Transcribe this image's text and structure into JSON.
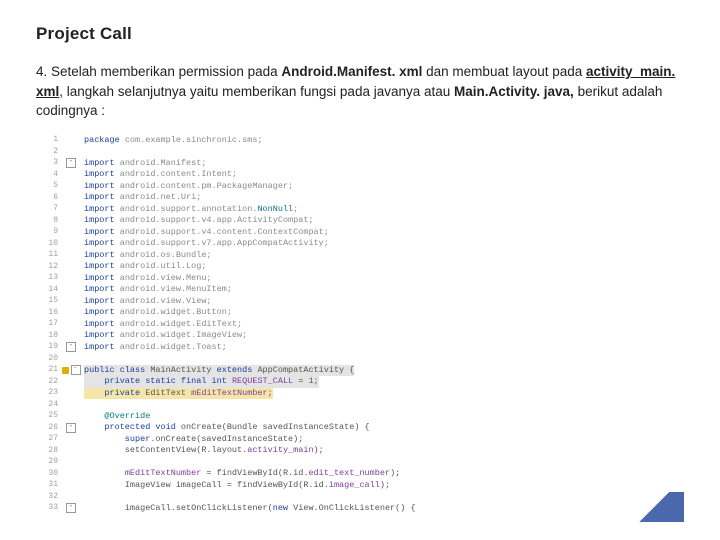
{
  "title": "Project Call",
  "paragraph": {
    "prefix": "4. Setelah memberikan permission pada ",
    "b1": "Android.Manifest. xml",
    "mid1": " dan membuat layout pada ",
    "b2": "activity_main. xml",
    "mid2": ", langkah selanjutnya yaitu memberikan fungsi pada javanya atau ",
    "b3": "Main.Activity. java,",
    "suffix": " berikut adalah codingnya :"
  },
  "lines": [
    {
      "n": 1,
      "fold": "",
      "code": [
        [
          "kw",
          "package "
        ],
        [
          "grey",
          "com.example.sinchronic.sms;"
        ]
      ]
    },
    {
      "n": 2,
      "fold": "",
      "code": []
    },
    {
      "n": 3,
      "fold": "-",
      "code": [
        [
          "kw",
          "import "
        ],
        [
          "grey",
          "android.Manifest;"
        ]
      ]
    },
    {
      "n": 4,
      "fold": "",
      "code": [
        [
          "kw",
          "import "
        ],
        [
          "grey",
          "android.content.Intent;"
        ]
      ]
    },
    {
      "n": 5,
      "fold": "",
      "code": [
        [
          "kw",
          "import "
        ],
        [
          "grey",
          "android.content.pm.PackageManager;"
        ]
      ]
    },
    {
      "n": 6,
      "fold": "",
      "code": [
        [
          "kw",
          "import "
        ],
        [
          "grey",
          "android.net.Uri;"
        ]
      ]
    },
    {
      "n": 7,
      "fold": "",
      "code": [
        [
          "kw",
          "import "
        ],
        [
          "grey",
          "android.support.annotation."
        ],
        [
          "teal",
          "NonNull"
        ],
        [
          "grey",
          ";"
        ]
      ]
    },
    {
      "n": 8,
      "fold": "",
      "code": [
        [
          "kw",
          "import "
        ],
        [
          "grey",
          "android.support.v4.app.ActivityCompat;"
        ]
      ]
    },
    {
      "n": 9,
      "fold": "",
      "code": [
        [
          "kw",
          "import "
        ],
        [
          "grey",
          "android.support.v4.content.ContextCompat;"
        ]
      ]
    },
    {
      "n": 10,
      "fold": "",
      "code": [
        [
          "kw",
          "import "
        ],
        [
          "grey",
          "android.support.v7.app.AppCompatActivity;"
        ]
      ]
    },
    {
      "n": 11,
      "fold": "",
      "code": [
        [
          "kw",
          "import "
        ],
        [
          "grey",
          "android.os.Bundle;"
        ]
      ]
    },
    {
      "n": 12,
      "fold": "",
      "code": [
        [
          "kw",
          "import "
        ],
        [
          "grey",
          "android.util.Log;"
        ]
      ]
    },
    {
      "n": 13,
      "fold": "",
      "code": [
        [
          "kw",
          "import "
        ],
        [
          "grey",
          "android.view.Menu;"
        ]
      ]
    },
    {
      "n": 14,
      "fold": "",
      "code": [
        [
          "kw",
          "import "
        ],
        [
          "grey",
          "android.view.MenuItem;"
        ]
      ]
    },
    {
      "n": 15,
      "fold": "",
      "code": [
        [
          "kw",
          "import "
        ],
        [
          "grey",
          "android.view.View;"
        ]
      ]
    },
    {
      "n": 16,
      "fold": "",
      "code": [
        [
          "kw",
          "import "
        ],
        [
          "grey",
          "android.widget.Button;"
        ]
      ]
    },
    {
      "n": 17,
      "fold": "",
      "code": [
        [
          "kw",
          "import "
        ],
        [
          "grey",
          "android.widget.EditText;"
        ]
      ]
    },
    {
      "n": 18,
      "fold": "",
      "code": [
        [
          "kw",
          "import "
        ],
        [
          "grey",
          "android.widget.ImageView;"
        ]
      ]
    },
    {
      "n": 19,
      "fold": "-",
      "code": [
        [
          "kw",
          "import "
        ],
        [
          "grey",
          "android.widget.Toast;"
        ]
      ]
    },
    {
      "n": 20,
      "fold": "",
      "code": []
    },
    {
      "n": 21,
      "fold": "-",
      "hl": "grey",
      "warn": true,
      "code": [
        [
          "kw",
          "public class "
        ],
        [
          "",
          "MainActivity "
        ],
        [
          "kw",
          "extends "
        ],
        [
          "",
          "AppCompatActivity {"
        ]
      ]
    },
    {
      "n": 22,
      "fold": "",
      "hl": "grey",
      "code": [
        [
          "kw",
          "    private static final int "
        ],
        [
          "purple",
          "REQUEST_CALL"
        ],
        [
          "",
          " = "
        ],
        [
          "",
          "1"
        ],
        [
          "",
          ";"
        ]
      ]
    },
    {
      "n": 23,
      "fold": "",
      "hl": "yellow",
      "code": [
        [
          "kw",
          "    private "
        ],
        [
          "",
          "EditText "
        ],
        [
          "purple",
          "mEditTextNumber"
        ],
        [
          "",
          ";"
        ]
      ]
    },
    {
      "n": 24,
      "fold": "",
      "code": []
    },
    {
      "n": 25,
      "fold": "",
      "code": [
        [
          "teal",
          "    @Override"
        ]
      ]
    },
    {
      "n": 26,
      "fold": "-",
      "code": [
        [
          "kw",
          "    protected void "
        ],
        [
          "",
          "onCreate(Bundle savedInstanceState) {"
        ]
      ]
    },
    {
      "n": 27,
      "fold": "",
      "code": [
        [
          "kw",
          "        super"
        ],
        [
          "",
          ".onCreate(savedInstanceState);"
        ]
      ]
    },
    {
      "n": 28,
      "fold": "",
      "code": [
        [
          "",
          "        setContentView(R.layout."
        ],
        [
          "purple",
          "activity_main"
        ],
        [
          "",
          ");"
        ]
      ]
    },
    {
      "n": 29,
      "fold": "",
      "code": []
    },
    {
      "n": 30,
      "fold": "",
      "code": [
        [
          "",
          "        "
        ],
        [
          "purple",
          "mEditTextNumber"
        ],
        [
          "",
          " = findViewById(R.id."
        ],
        [
          "purple",
          "edit_text_number"
        ],
        [
          "",
          ");"
        ]
      ]
    },
    {
      "n": 31,
      "fold": "",
      "code": [
        [
          "",
          "        ImageView imageCall = findViewById(R.id."
        ],
        [
          "purple",
          "image_call"
        ],
        [
          "",
          ");"
        ]
      ]
    },
    {
      "n": 32,
      "fold": "",
      "code": []
    },
    {
      "n": 33,
      "fold": "-",
      "code": [
        [
          "",
          "        imageCall.setOnClickListener("
        ],
        [
          "kw",
          "new "
        ],
        [
          "",
          "View.OnClickListener() {"
        ]
      ]
    }
  ]
}
